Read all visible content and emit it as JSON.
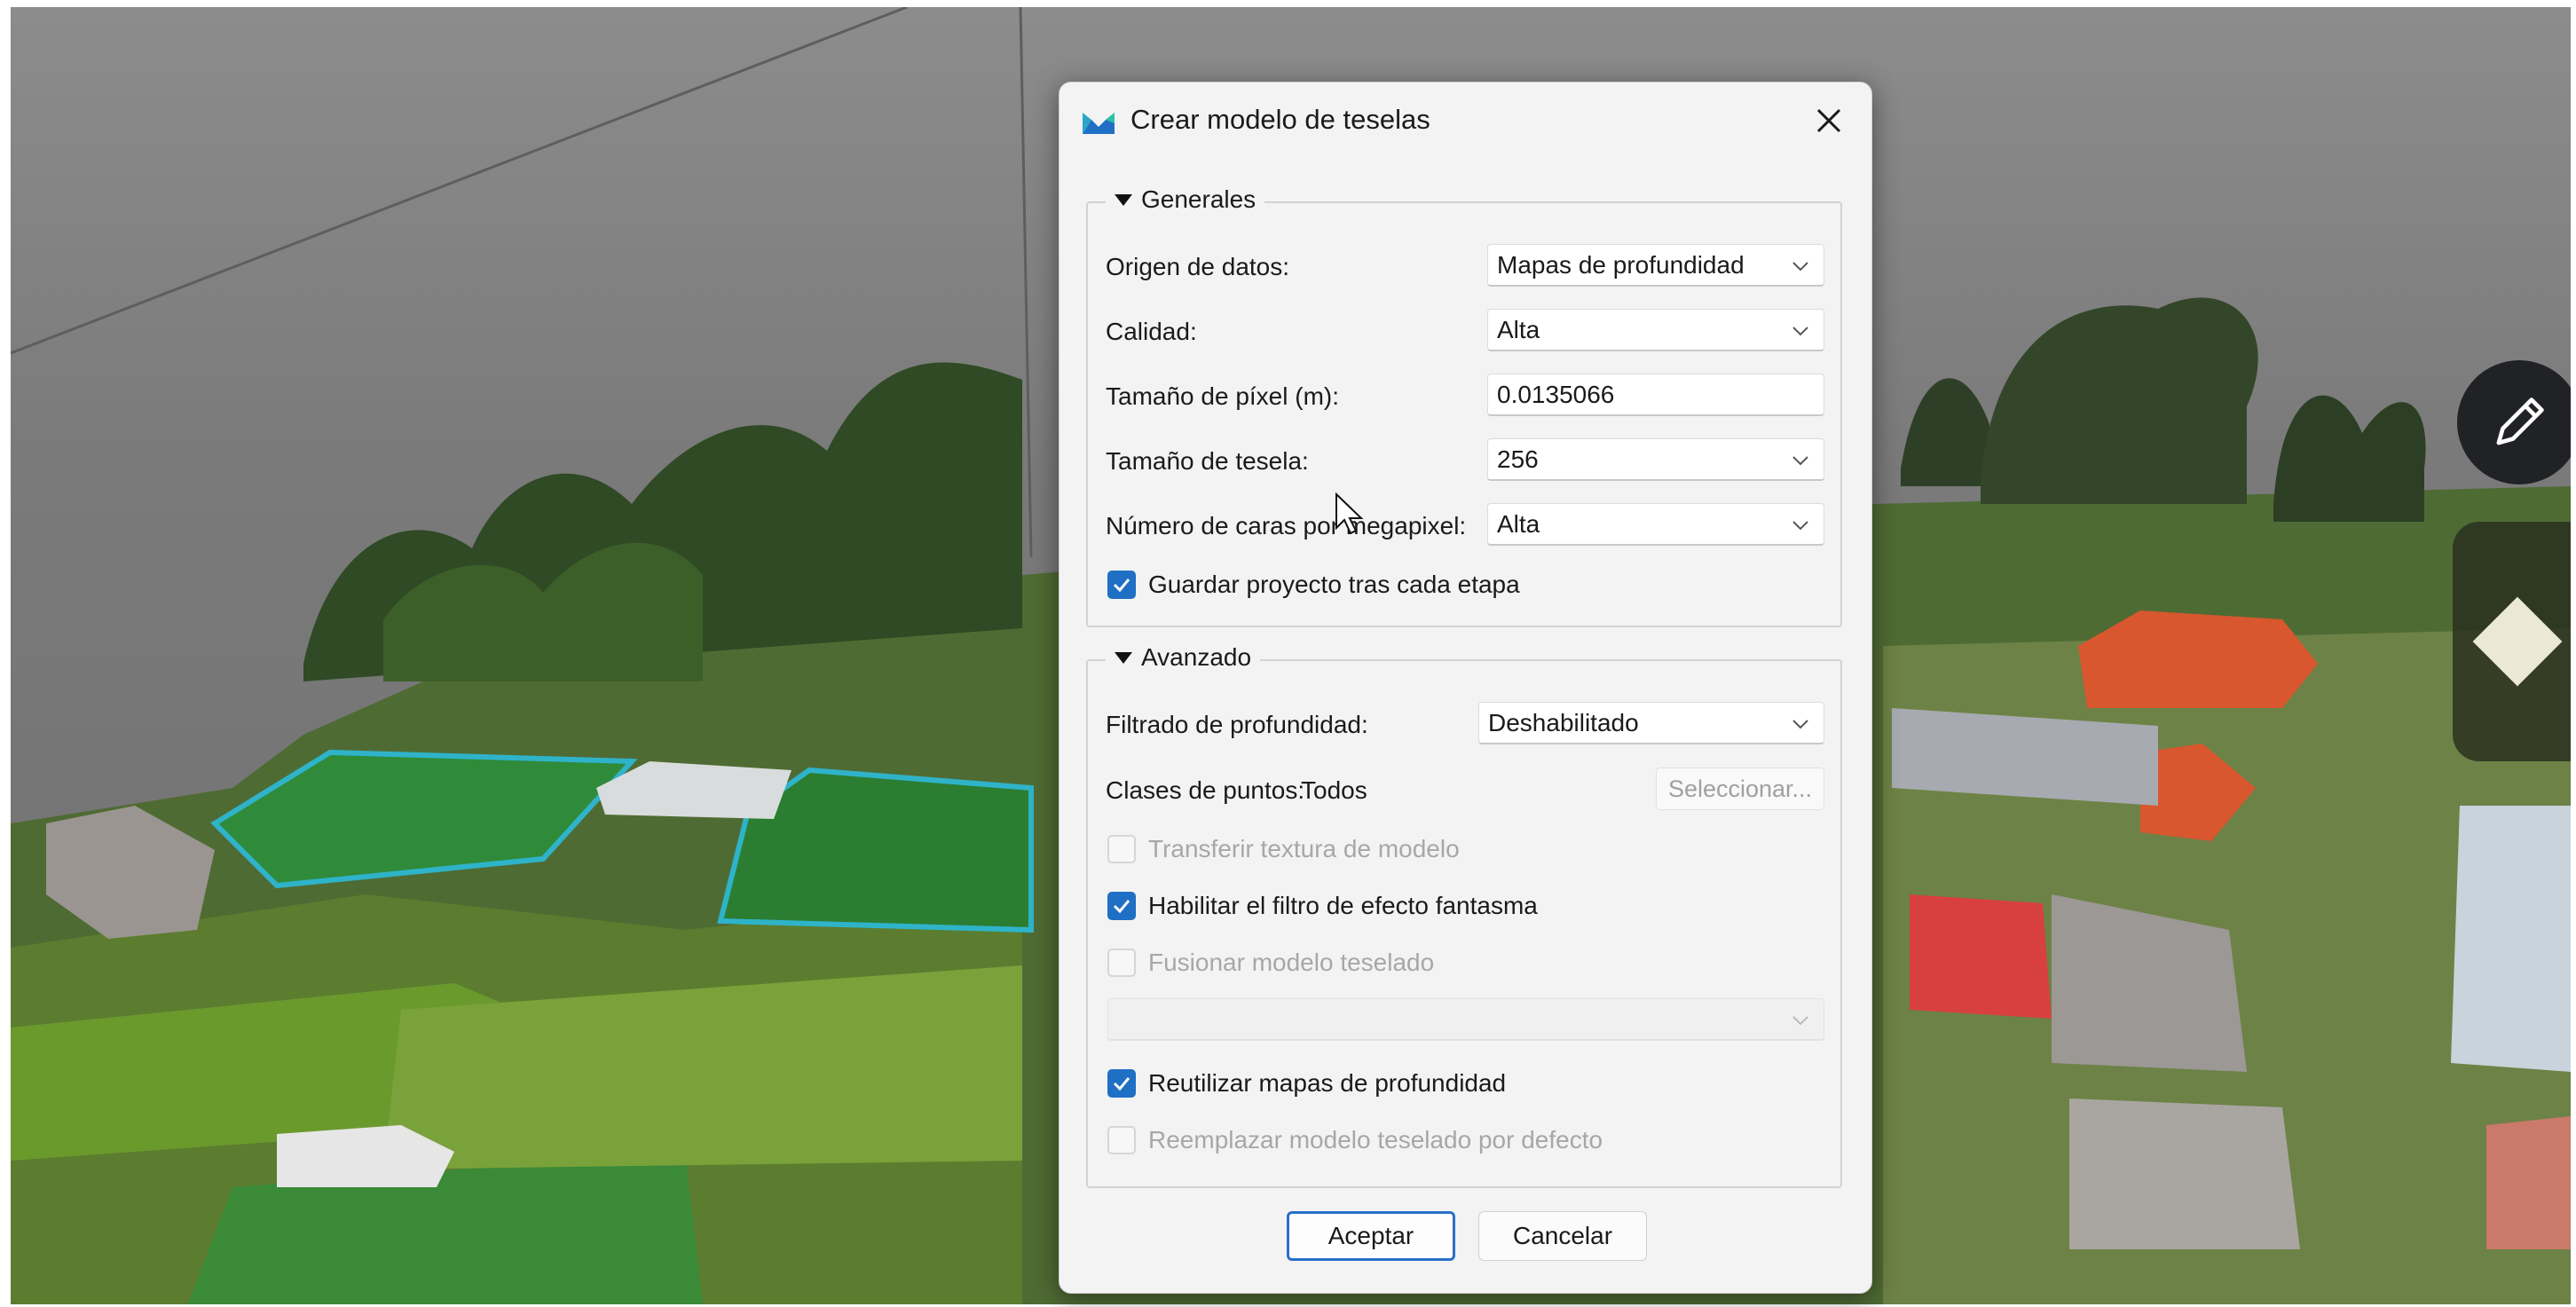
{
  "dialog": {
    "title": "Crear modelo de teselas",
    "close_icon": "close-icon",
    "app_icon": "metashape-logo-icon"
  },
  "general": {
    "legend": "Generales",
    "source_label": "Origen de datos:",
    "source_value": "Mapas de profundidad",
    "quality_label": "Calidad:",
    "quality_value": "Alta",
    "pixel_label": "Tamaño de píxel (m):",
    "pixel_value": "0.0135066",
    "tile_label": "Tamaño de tesela:",
    "tile_value": "256",
    "faces_label": "Número de caras por megapixel:",
    "faces_value": "Alta",
    "save_project_label": "Guardar proyecto tras cada etapa",
    "save_project_checked": true
  },
  "advanced": {
    "legend": "Avanzado",
    "depth_filter_label": "Filtrado de profundidad:",
    "depth_filter_value": "Deshabilitado",
    "point_classes_label": "Clases de puntos:",
    "point_classes_value": "Todos",
    "select_button": "Seleccionar...",
    "transfer_texture_label": "Transferir textura de modelo",
    "transfer_texture_checked": false,
    "ghost_filter_label": "Habilitar el filtro de efecto fantasma",
    "ghost_filter_checked": true,
    "merge_label": "Fusionar modelo teselado",
    "merge_checked": false,
    "merge_combo_value": "",
    "reuse_depth_label": "Reutilizar mapas de profundidad",
    "reuse_depth_checked": true,
    "replace_default_label": "Reemplazar modelo teselado por defecto",
    "replace_default_checked": false
  },
  "buttons": {
    "accept": "Aceptar",
    "cancel": "Cancelar"
  },
  "colors": {
    "accent": "#1f6fc5",
    "dialog_bg": "#f3f3f3"
  },
  "side_tools": [
    "pencil-icon",
    "diamond-icon"
  ]
}
